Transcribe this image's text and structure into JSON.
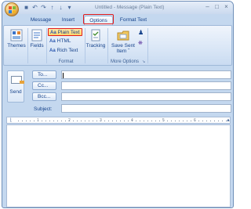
{
  "window": {
    "title": "Untitled - Message (Plain Text)"
  },
  "tabs": [
    {
      "label": "Message"
    },
    {
      "label": "Insert"
    },
    {
      "label": "Options"
    },
    {
      "label": "Format Text"
    }
  ],
  "ribbon": {
    "themes": {
      "label": "Themes",
      "dropdown": "ˇ"
    },
    "fields": {
      "label": "Fields",
      "dropdown": "ˇ"
    },
    "format_group": {
      "items": [
        {
          "prefix": "Aa",
          "label": "Plain Text",
          "selected": true
        },
        {
          "prefix": "Aa",
          "label": "HTML"
        },
        {
          "prefix": "Aa",
          "label": "Rich Text"
        }
      ],
      "label": "Format"
    },
    "tracking": {
      "label": "Tracking",
      "dropdown": "ˇ"
    },
    "save_sent_item": {
      "line1": "Save Sent",
      "line2": "Item ˇ"
    },
    "more_options_label": "More Options",
    "dialog_launcher": "↘"
  },
  "header": {
    "send_label": "Send",
    "to_button": "To...",
    "cc_button": "Cc...",
    "bcc_button": "Bcc...",
    "subject_label": "Subject:",
    "to_value": "",
    "cc_value": "",
    "bcc_value": "",
    "subject_value": ""
  },
  "ruler": {
    "marks": [
      "1",
      "2",
      "3",
      "4",
      "5",
      "6"
    ]
  },
  "colors": {
    "accent": "#15428b",
    "highlight": "#e21b1b",
    "ribbon": "#d9e6f6"
  }
}
